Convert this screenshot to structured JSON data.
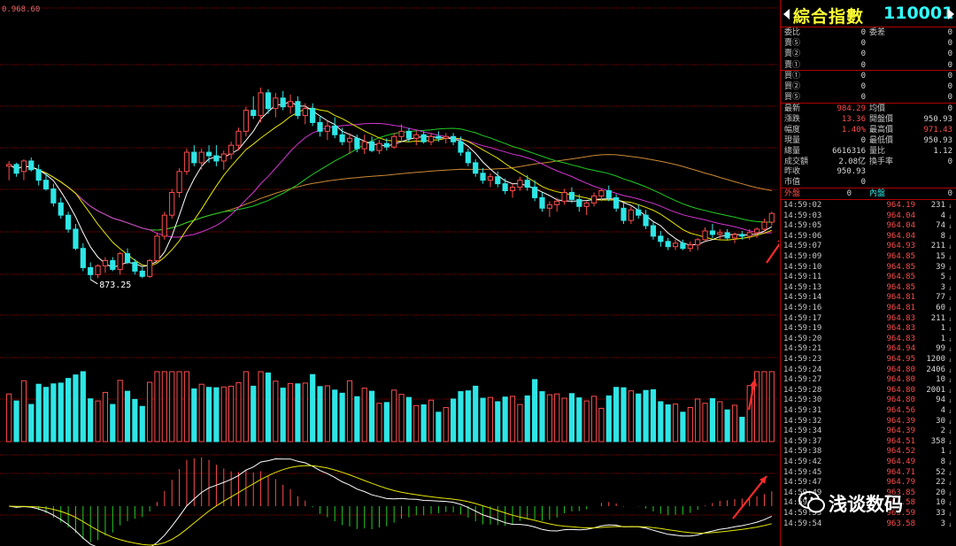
{
  "chart": {
    "top_price_label": "0.968.60",
    "low_label": "873.25",
    "colors": {
      "up": "#ff4c4c",
      "down": "#2ee6e6",
      "ma5": "#ffffff",
      "ma10": "#e6e600",
      "ma20": "#d633d6",
      "ma30": "#22cc22",
      "ma60": "#cc8833",
      "arrow": "#ff2a2a",
      "grid": "#8a0000"
    }
  },
  "chart_data": {
    "type": "candlestick",
    "low_annotation": 873.25,
    "price_ylim": [
      862,
      985
    ],
    "candles": [
      [
        938,
        941,
        930,
        939
      ],
      [
        939,
        940,
        932,
        934
      ],
      [
        935,
        942,
        930,
        941
      ],
      [
        941,
        943,
        935,
        936
      ],
      [
        936,
        939,
        927,
        930
      ],
      [
        930,
        934,
        924,
        925
      ],
      [
        925,
        928,
        915,
        917
      ],
      [
        917,
        920,
        908,
        910
      ],
      [
        910,
        912,
        900,
        902
      ],
      [
        902,
        905,
        890,
        891
      ],
      [
        891,
        894,
        878,
        880
      ],
      [
        880,
        883,
        873.25,
        876
      ],
      [
        876,
        882,
        874,
        881
      ],
      [
        881,
        886,
        877,
        884
      ],
      [
        884,
        886,
        878,
        879
      ],
      [
        879,
        889,
        876,
        888
      ],
      [
        888,
        891,
        882,
        883
      ],
      [
        883,
        885,
        876,
        878
      ],
      [
        878,
        880,
        874,
        875
      ],
      [
        875,
        885,
        874,
        884
      ],
      [
        884,
        900,
        883,
        898
      ],
      [
        898,
        912,
        896,
        910
      ],
      [
        910,
        925,
        908,
        923
      ],
      [
        923,
        937,
        920,
        935
      ],
      [
        935,
        948,
        933,
        946
      ],
      [
        946,
        950,
        938,
        940
      ],
      [
        940,
        948,
        936,
        946
      ],
      [
        946,
        950,
        940,
        944
      ],
      [
        944,
        950,
        938,
        941
      ],
      [
        941,
        947,
        936,
        945
      ],
      [
        945,
        952,
        942,
        950
      ],
      [
        950,
        960,
        947,
        958
      ],
      [
        958,
        972,
        955,
        970
      ],
      [
        970,
        978,
        965,
        967
      ],
      [
        967,
        983,
        963,
        980
      ],
      [
        980,
        982,
        968,
        971
      ],
      [
        971,
        980,
        966,
        977
      ],
      [
        977,
        981,
        970,
        972
      ],
      [
        972,
        979,
        968,
        975
      ],
      [
        975,
        978,
        965,
        967
      ],
      [
        967,
        974,
        962,
        971
      ],
      [
        971,
        974,
        961,
        963
      ],
      [
        963,
        967,
        955,
        958
      ],
      [
        958,
        964,
        953,
        961
      ],
      [
        961,
        966,
        954,
        956
      ],
      [
        956,
        960,
        950,
        952
      ],
      [
        952,
        957,
        945,
        954
      ],
      [
        954,
        956,
        946,
        948
      ],
      [
        948,
        956,
        945,
        952
      ],
      [
        952,
        955,
        946,
        947
      ],
      [
        947,
        953,
        945,
        951
      ],
      [
        951,
        954,
        947,
        949
      ],
      [
        949,
        957,
        948,
        955
      ],
      [
        955,
        962,
        952,
        958
      ],
      [
        958,
        960,
        952,
        954
      ],
      [
        954,
        958,
        950,
        956
      ],
      [
        956,
        958,
        951,
        952
      ],
      [
        952,
        957,
        950,
        955
      ],
      [
        955,
        958,
        952,
        954
      ],
      [
        954,
        957,
        951,
        955
      ],
      [
        955,
        957,
        950,
        952
      ],
      [
        952,
        955,
        944,
        946
      ],
      [
        946,
        948,
        938,
        940
      ],
      [
        940,
        942,
        932,
        934
      ],
      [
        934,
        937,
        928,
        930
      ],
      [
        930,
        934,
        926,
        932
      ],
      [
        932,
        935,
        926,
        928
      ],
      [
        928,
        931,
        922,
        924
      ],
      [
        924,
        928,
        920,
        926
      ],
      [
        926,
        932,
        924,
        930
      ],
      [
        930,
        933,
        924,
        926
      ],
      [
        926,
        930,
        918,
        920
      ],
      [
        920,
        923,
        912,
        914
      ],
      [
        914,
        918,
        909,
        916
      ],
      [
        916,
        920,
        912,
        918
      ],
      [
        918,
        925,
        916,
        923
      ],
      [
        923,
        926,
        917,
        919
      ],
      [
        919,
        922,
        912,
        915
      ],
      [
        915,
        918,
        910,
        917
      ],
      [
        917,
        923,
        915,
        921
      ],
      [
        921,
        925,
        918,
        924
      ],
      [
        924,
        927,
        918,
        920
      ],
      [
        920,
        922,
        912,
        914
      ],
      [
        914,
        917,
        905,
        907
      ],
      [
        907,
        915,
        905,
        913
      ],
      [
        913,
        916,
        908,
        910
      ],
      [
        910,
        913,
        902,
        904
      ],
      [
        904,
        906,
        896,
        898
      ],
      [
        898,
        901,
        892,
        895
      ],
      [
        895,
        897,
        890,
        892
      ],
      [
        892,
        896,
        890,
        894
      ],
      [
        894,
        896,
        890,
        891
      ],
      [
        891,
        895,
        889,
        893
      ],
      [
        893,
        897,
        890,
        896
      ],
      [
        896,
        903,
        895,
        901
      ],
      [
        901,
        905,
        897,
        899
      ],
      [
        899,
        902,
        896,
        900
      ],
      [
        900,
        902,
        896,
        897
      ],
      [
        897,
        900,
        894,
        899
      ],
      [
        899,
        901,
        896,
        898
      ],
      [
        898,
        902,
        896,
        900
      ],
      [
        900,
        903,
        897,
        902
      ],
      [
        902,
        908,
        901,
        906
      ],
      [
        906,
        912,
        904,
        911
      ]
    ]
  },
  "panel": {
    "title": "綜合指數",
    "code": "110001",
    "order_book": [
      {
        "label": "委比",
        "value": "0",
        "label2": "委差",
        "value2": "0"
      },
      {
        "label": "賣⑤",
        "value": "0",
        "value2": "0"
      },
      {
        "label": "賣②",
        "value": "0",
        "value2": "0"
      },
      {
        "label": "賣①",
        "value": "0",
        "value2": "0"
      },
      {
        "label": "買①",
        "value": "0",
        "value2": "0"
      },
      {
        "label": "買②",
        "value": "0",
        "value2": "0"
      },
      {
        "label": "買⑤",
        "value": "0",
        "value2": "0"
      }
    ],
    "quote": [
      {
        "l1": "最新",
        "v1": "984.29",
        "c1": "red",
        "l2": "均價",
        "v2": "0",
        "c2": ""
      },
      {
        "l1": "漲跌",
        "v1": "13.36",
        "c1": "red",
        "l2": "開盤價",
        "v2": "950.93",
        "c2": ""
      },
      {
        "l1": "幅度",
        "v1": "1.40%",
        "c1": "red",
        "l2": "最高價",
        "v2": "971.43",
        "c2": "red"
      },
      {
        "l1": "現量",
        "v1": "0",
        "c1": "",
        "l2": "最低價",
        "v2": "950.93",
        "c2": ""
      },
      {
        "l1": "總量",
        "v1": "6616316",
        "c1": "",
        "l2": "量比",
        "v2": "1.12",
        "c2": ""
      },
      {
        "l1": "成交額",
        "v1": "2.08亿",
        "c1": "",
        "l2": "換手率",
        "v2": "0",
        "c2": ""
      },
      {
        "l1": "昨收",
        "v1": "950.93",
        "c1": "",
        "l2": "",
        "v2": "",
        "c2": ""
      },
      {
        "l1": "市值",
        "v1": "0",
        "c1": "",
        "l2": "",
        "v2": "",
        "c2": ""
      }
    ],
    "outer_inner": {
      "l1": "外盤",
      "v1": "0",
      "l2": "內盤",
      "v2": "0"
    },
    "ticks": [
      [
        "14:59:02",
        "964.19",
        "231"
      ],
      [
        "14:59:03",
        "964.04",
        "4"
      ],
      [
        "14:59:05",
        "964.04",
        "74"
      ],
      [
        "14:59:06",
        "964.04",
        "8"
      ],
      [
        "14:59:07",
        "964.93",
        "211"
      ],
      [
        "14:59:09",
        "964.85",
        "15"
      ],
      [
        "14:59:10",
        "964.85",
        "39"
      ],
      [
        "14:59:11",
        "964.85",
        "5"
      ],
      [
        "14:59:13",
        "964.85",
        "3"
      ],
      [
        "14:59:14",
        "964.81",
        "77"
      ],
      [
        "14:59:16",
        "964.81",
        "60"
      ],
      [
        "14:59:17",
        "964.83",
        "211"
      ],
      [
        "14:59:19",
        "964.83",
        "1"
      ],
      [
        "14:59:20",
        "964.83",
        "1"
      ],
      [
        "14:59:21",
        "964.94",
        "99"
      ],
      [
        "14:59:23",
        "964.95",
        "1200"
      ],
      [
        "14:59:24",
        "964.80",
        "2406"
      ],
      [
        "14:59:27",
        "964.80",
        "10"
      ],
      [
        "14:59:28",
        "964.80",
        "2001"
      ],
      [
        "14:59:30",
        "964.80",
        "94"
      ],
      [
        "14:59:31",
        "964.56",
        "4"
      ],
      [
        "14:59:32",
        "964.39",
        "30"
      ],
      [
        "14:59:34",
        "964.39",
        "2"
      ],
      [
        "14:59:37",
        "964.51",
        "358"
      ],
      [
        "14:59:38",
        "964.52",
        "1"
      ],
      [
        "14:59:42",
        "964.49",
        "8"
      ],
      [
        "14:59:45",
        "964.71",
        "52"
      ],
      [
        "14:59:47",
        "964.79",
        "22"
      ],
      [
        "14:59:49",
        "963.85",
        "20"
      ],
      [
        "14:59:51",
        "963.58",
        "10"
      ],
      [
        "14:59:53",
        "963.59",
        "33"
      ],
      [
        "14:59:54",
        "963.58",
        "3"
      ]
    ]
  },
  "watermark": {
    "text": "浅谈数码",
    "icon": "wechat-icon"
  }
}
